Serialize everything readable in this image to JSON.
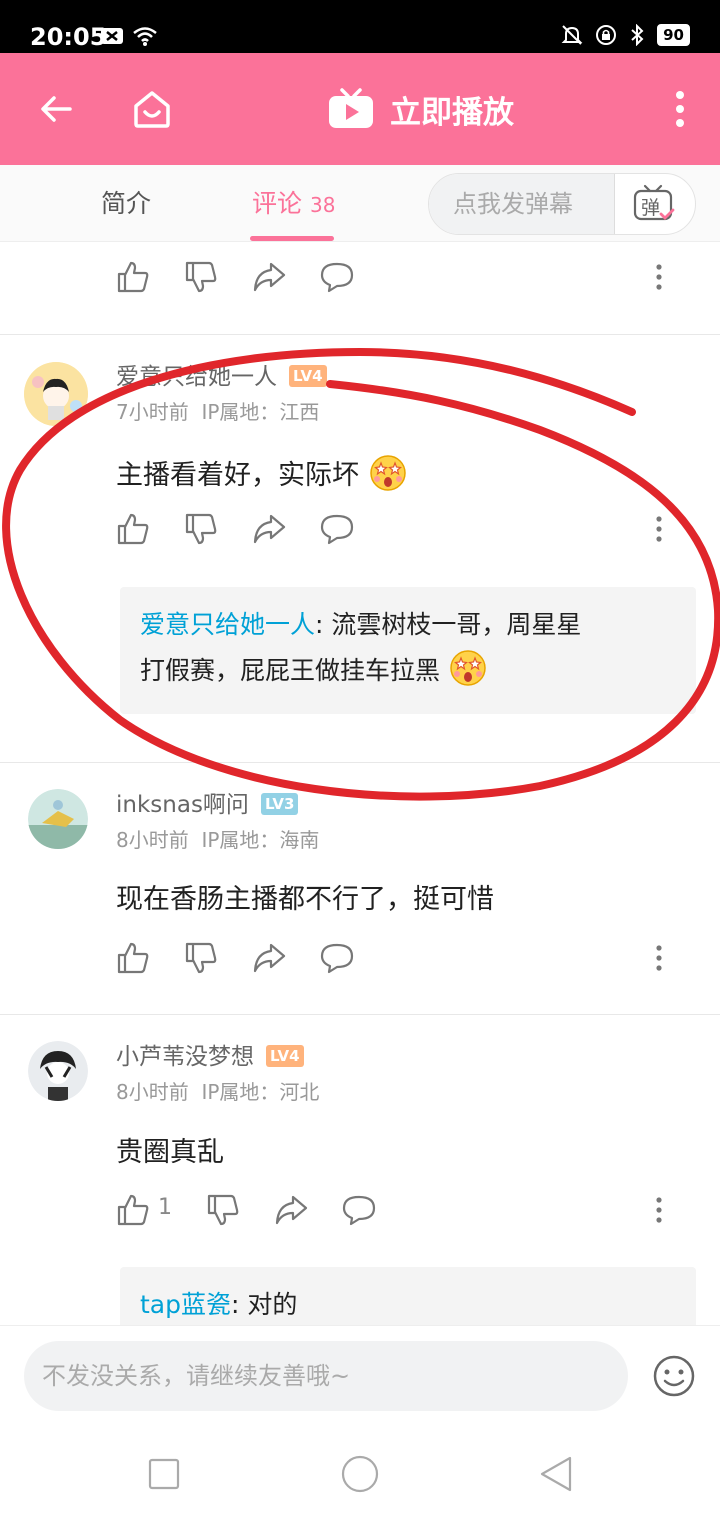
{
  "status_bar": {
    "time": "20:05",
    "battery": "90",
    "icons": [
      "notification-icon",
      "wifi-icon",
      "mute-icon",
      "lock-rotation-icon",
      "bluetooth-icon",
      "battery-icon"
    ]
  },
  "app_bar": {
    "title": "立即播放",
    "color": "#fb7299",
    "icons": [
      "back-arrow-icon",
      "home-icon",
      "tv-play-icon",
      "more-vertical-icon"
    ]
  },
  "tabs": {
    "intro": "简介",
    "comments": "评论",
    "comments_count": "38",
    "danmaku_placeholder": "点我发弹幕",
    "danmaku_button": "弹"
  },
  "comments": [
    {
      "username": "爱意只给她一人",
      "level": "LV4",
      "time": "7小时前",
      "ip": "IP属地：江西",
      "text": "主播看着好，实际坏",
      "reply": {
        "user": "爱意只给她一人",
        "separator": ":",
        "text_line1": "流雲树枝一哥，周星星",
        "text_line2": "打假赛，屁屁王做挂车拉黑"
      }
    },
    {
      "username": "inksnas啊问",
      "level": "LV3",
      "time": "8小时前",
      "ip": "IP属地：海南",
      "text": "现在香肠主播都不行了，挺可惜"
    },
    {
      "username": "小芦苇没梦想",
      "level": "LV4",
      "time": "8小时前",
      "ip": "IP属地：河北",
      "text": "贵圈真乱",
      "likes": "1",
      "reply": {
        "user": "tap蓝瓷",
        "separator": ":",
        "text_line1": "对的"
      }
    }
  ],
  "bottom_bar": {
    "placeholder": "不发没关系，请继续友善哦~"
  },
  "annotation_color": "#e0262b"
}
